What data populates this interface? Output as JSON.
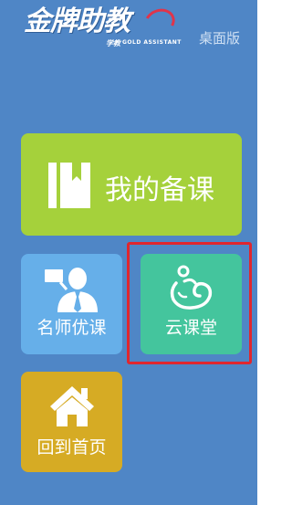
{
  "header": {
    "logo_text": "金牌助教",
    "logo_sub_cn": "学教",
    "logo_sub_en": "GOLD ASSISTANT",
    "desktop_link": "桌面版"
  },
  "tiles": {
    "lesson_prep": {
      "label": "我的备课",
      "icon": "book-icon",
      "color": "#a5d13b"
    },
    "famous_teacher": {
      "label": "名师优课",
      "icon": "teacher-icon",
      "color": "#66afe9"
    },
    "cloud_classroom": {
      "label": "云课堂",
      "icon": "cloud-classroom-icon",
      "color": "#44c59d"
    },
    "home": {
      "label": "回到首页",
      "icon": "home-icon",
      "color": "#d6ab24"
    }
  },
  "highlight_color": "#e0262e",
  "background_color": "#4f86c6"
}
